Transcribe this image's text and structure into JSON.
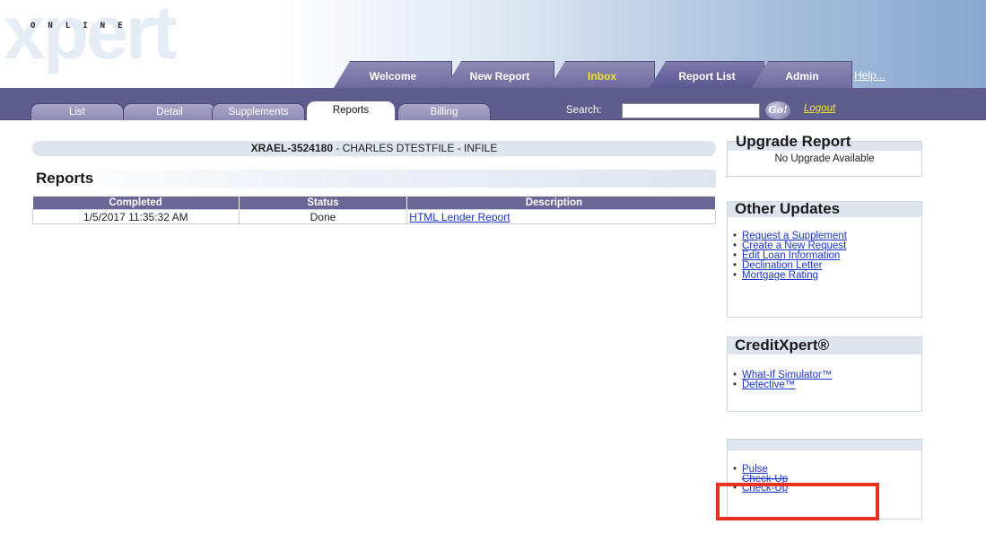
{
  "header": {
    "logo_main": "xpert",
    "logo_sub": "ONLINE",
    "help_label": "Help..."
  },
  "top_tabs": [
    {
      "label": "Welcome"
    },
    {
      "label": "New Report"
    },
    {
      "label": "Inbox"
    },
    {
      "label": "Report List"
    },
    {
      "label": "Admin"
    }
  ],
  "sub_tabs": [
    {
      "label": "List"
    },
    {
      "label": "Detail"
    },
    {
      "label": "Supplements"
    },
    {
      "label": "Reports"
    },
    {
      "label": "Billing"
    }
  ],
  "search": {
    "label": "Search:",
    "value": "",
    "go_label": "Go!"
  },
  "logout_label": "Logout",
  "file": {
    "id": "XRAEL-3524180",
    "rest": " - CHARLES DTESTFILE - INFILE"
  },
  "reports": {
    "heading": "Reports",
    "columns": [
      "Completed",
      "Status",
      "Description"
    ],
    "rows": [
      {
        "completed": "1/5/2017 11:35:32 AM",
        "status": "Done",
        "description": "HTML Lender Report"
      }
    ]
  },
  "sidebar": {
    "upgrade_title": "Upgrade Report",
    "upgrade_note": "No Upgrade Available",
    "other_title": "Other Updates",
    "other_links": [
      "Request a Supplement",
      "Create a New Request",
      "Edit Loan Information",
      "Declination Letter",
      "Mortgage Rating"
    ],
    "creditxpert_title": "CreditXpert®",
    "creditxpert_links": [
      "What-If Simulator™",
      "Detective™"
    ],
    "misc_title": "",
    "misc_links": [
      "Pulse",
      "Check-Up",
      "Check-Up"
    ]
  },
  "colors": {
    "tab_purple": "#6f6b9e",
    "subbar_purple": "#5e5b8d",
    "link_blue": "#1a35c9",
    "inbox_yellow": "#f2e23a",
    "highlight_red": "#e8321e"
  }
}
